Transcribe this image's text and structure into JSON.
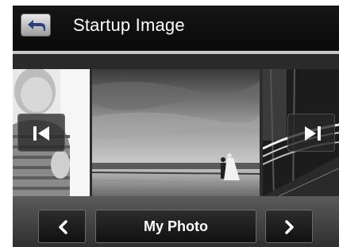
{
  "header": {
    "title": "Startup Image",
    "back_icon": "back-arrow-icon"
  },
  "carousel": {
    "items": [
      {
        "id": "child-photo",
        "position": "previous"
      },
      {
        "id": "beach-wedding-photo",
        "position": "current"
      },
      {
        "id": "night-road-photo",
        "position": "next"
      }
    ],
    "prev_icon": "skip-previous-icon",
    "next_icon": "skip-next-icon"
  },
  "controls": {
    "selected_option": "My Photo",
    "prev_icon": "chevron-left-icon",
    "next_icon": "chevron-right-icon"
  },
  "colors": {
    "background": "#111111",
    "header_text": "#ffffff",
    "divider": "#c8c8c8",
    "bottom_bar": "#4a4a4a"
  }
}
